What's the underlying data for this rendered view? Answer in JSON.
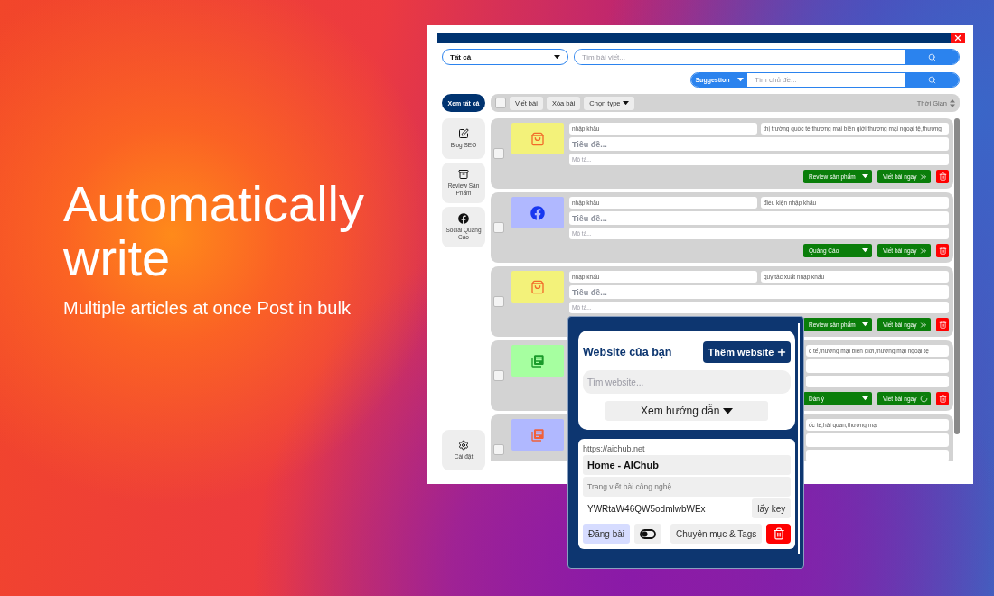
{
  "headline": {
    "title": "Automatically write",
    "subtitle": "Multiple articles at once Post in bulk"
  },
  "filter": {
    "value": "Tất cả"
  },
  "search": {
    "placeholder": "Tìm bài viết..."
  },
  "suggestion": {
    "label": "Suggestion",
    "placeholder": "Tìm chủ đề..."
  },
  "view_all": "Xem tất cả",
  "toolbar": {
    "checked": false,
    "buttons": [
      "Viết bài",
      "Xóa bài"
    ],
    "type_menu": "Chọn type",
    "sort": "Thời Gian"
  },
  "sidebar": {
    "items": [
      {
        "kind": "edit",
        "label": "Blog SEO"
      },
      {
        "kind": "archive",
        "label": "Review Sản Phẩm"
      },
      {
        "kind": "facebook",
        "label": "Social Quảng Cáo"
      }
    ],
    "settings": "Cài đặt"
  },
  "posts": [
    {
      "checked": false,
      "color": "#f3f27a",
      "icon": {
        "kind": "shop",
        "color": "#f26b2a"
      },
      "keyword": "nhập khẩu",
      "tags": "thị trường quốc tế,thương mại biên giới,thương mại ngoại tệ,thương",
      "title_placeholder": "Tiêu đề...",
      "description_placeholder": "Mô tả...",
      "type": "Review sản phẩm",
      "action": "Viết bài ngay",
      "busy": false
    },
    {
      "checked": false,
      "color": "#b0b8ff",
      "icon": {
        "kind": "facebook",
        "color": "#1737f0"
      },
      "keyword": "nhập khẩu",
      "tags": "điều kiện nhập khẩu",
      "title_placeholder": "Tiêu đề...",
      "description_placeholder": "Mô tả...",
      "type": "Quảng Cáo",
      "action": "Viết bài ngay",
      "busy": false
    },
    {
      "checked": false,
      "color": "#f3f27a",
      "icon": {
        "kind": "shop",
        "color": "#f26b2a"
      },
      "keyword": "nhập khẩu",
      "tags": "quy tắc xuất nhập khẩu",
      "title_placeholder": "Tiêu đề...",
      "description_placeholder": "Mô tả...",
      "type": "Review sản phẩm",
      "action": "Viết bài ngay",
      "busy": false
    },
    {
      "checked": false,
      "color": "#a6ffa0",
      "icon": {
        "kind": "notes",
        "color": "#1a9a2a"
      },
      "tags": "c tế,thương mại biên giới,thương mại ngoại tệ",
      "type": "Dàn ý",
      "action": "Viết bài ngay",
      "busy": true
    },
    {
      "checked": false,
      "color": "#b0b8ff",
      "icon": {
        "kind": "notes",
        "color": "#f0603a"
      },
      "tags": "ốc tế,hải quan,thương mại"
    }
  ],
  "website_panel": {
    "title": "Website của bạn",
    "add_button": "Thêm website",
    "search_placeholder": "Tìm website...",
    "guide_button": "Xem hướng dẫn",
    "site": {
      "url": "https://aichub.net",
      "name": "Home - AIChub",
      "description": "Trang viết bài công nghệ",
      "key": "YWRtaW46QW5odmlwbWEx",
      "key_button": "lấy key",
      "post_button": "Đăng bài",
      "auto_on": false,
      "categories_button": "Chuyên mục & Tags"
    }
  }
}
